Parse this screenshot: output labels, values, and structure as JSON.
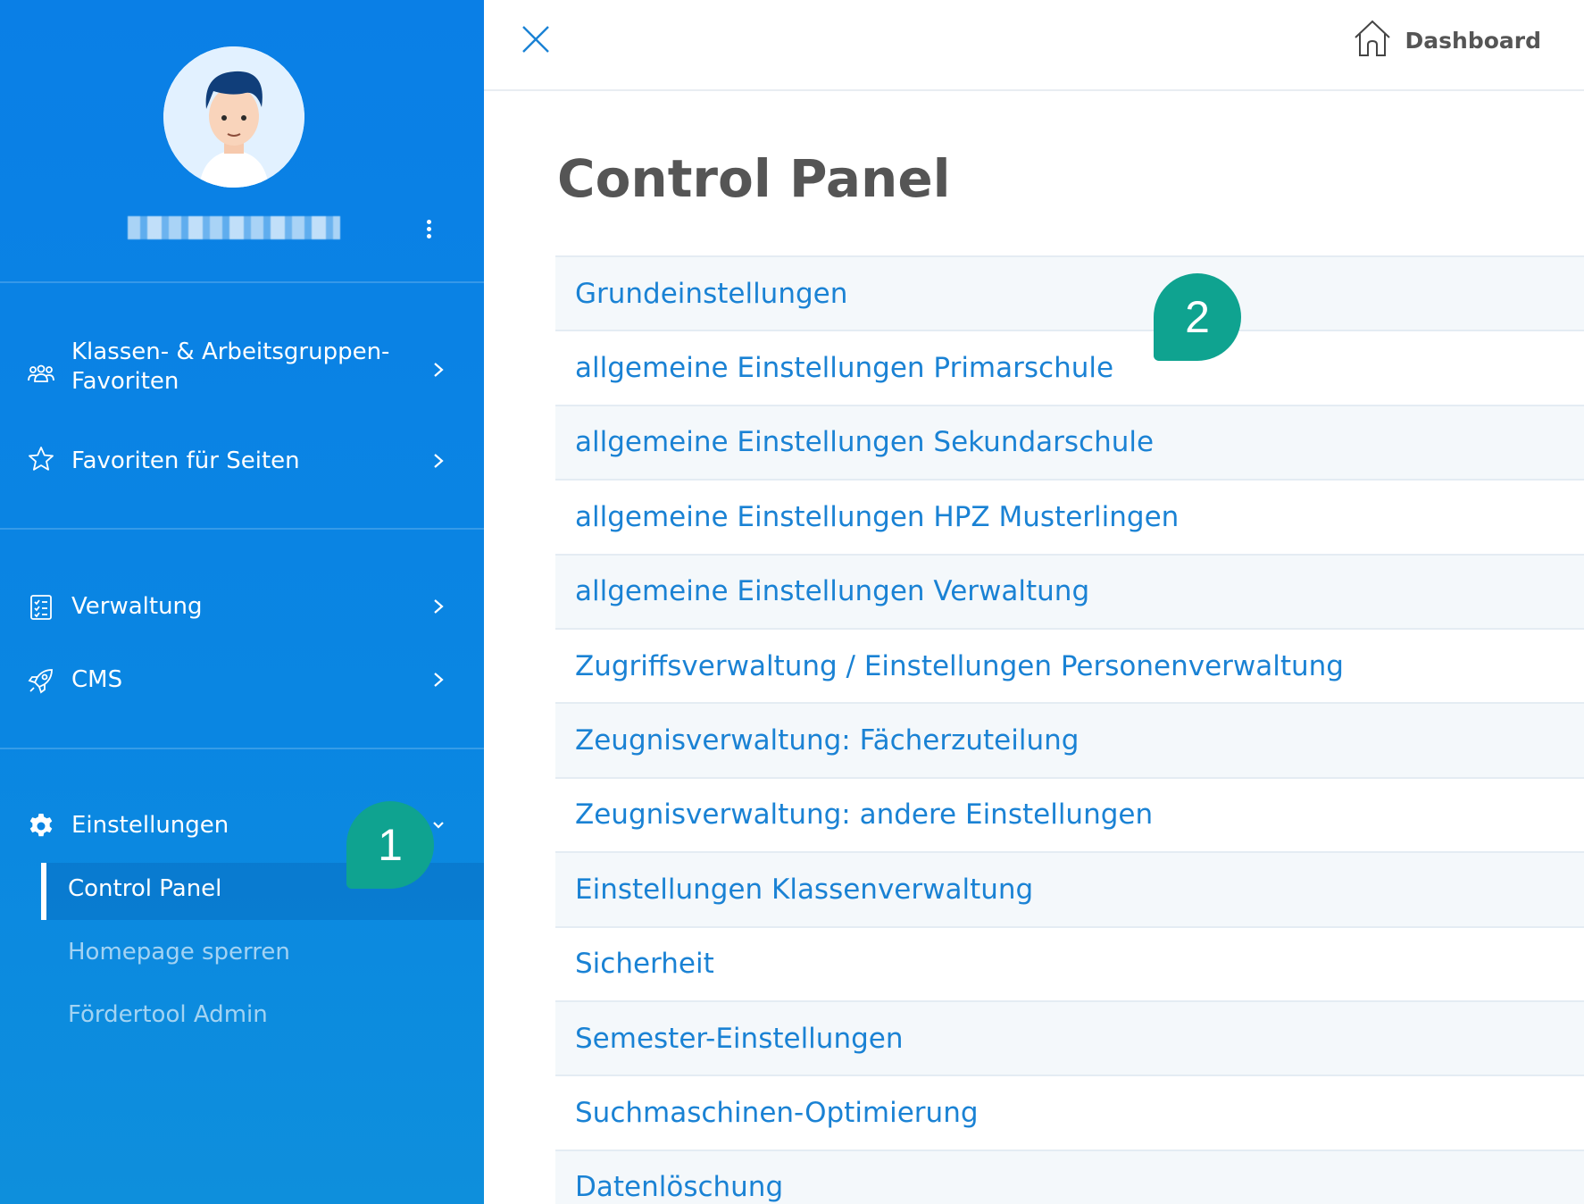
{
  "sidebar": {
    "nav": [
      {
        "label": "Klassen- & Arbeitsgruppen-\nFavoriten",
        "icon": "users-icon"
      },
      {
        "label": "Favoriten für Seiten",
        "icon": "star-icon"
      },
      {
        "label": "Verwaltung",
        "icon": "checklist-icon"
      },
      {
        "label": "CMS",
        "icon": "rocket-icon"
      },
      {
        "label": "Einstellungen",
        "icon": "gear-icon"
      }
    ],
    "sub_items": [
      "Control Panel",
      "Homepage sperren",
      "Fördertool Admin"
    ]
  },
  "topbar": {
    "dashboard_label": "Dashboard"
  },
  "main": {
    "title": "Control Panel",
    "items": [
      "Grundeinstellungen",
      "allgemeine Einstellungen Primarschule",
      "allgemeine Einstellungen Sekundarschule",
      "allgemeine Einstellungen HPZ Musterlingen",
      "allgemeine Einstellungen Verwaltung",
      "Zugriffsverwaltung / Einstellungen Personenverwaltung",
      "Zeugnisverwaltung: Fächerzuteilung",
      "Zeugnisverwaltung: andere Einstellungen",
      "Einstellungen Klassenverwaltung",
      "Sicherheit",
      "Semester-Einstellungen",
      "Suchmaschinen-Optimierung",
      "Datenlöschung"
    ]
  },
  "callouts": [
    "1",
    "2"
  ],
  "colors": {
    "sidebar": "#0a82e4",
    "link": "#1a82d4",
    "callout": "#0fa390",
    "title": "#555555"
  }
}
